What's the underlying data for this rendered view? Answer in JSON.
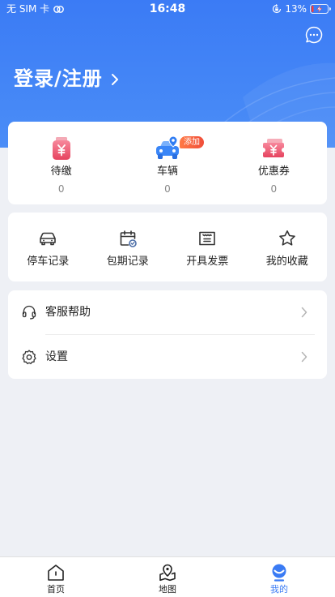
{
  "status_bar": {
    "carrier": "无 SIM 卡",
    "time": "16:48",
    "battery_text": "13%",
    "battery_level": 13
  },
  "header": {
    "login_label": "登录/注册"
  },
  "quick": {
    "items": [
      {
        "label": "待缴",
        "count": "0",
        "icon": "wallet-yuan-icon"
      },
      {
        "label": "车辆",
        "count": "0",
        "icon": "car-icon",
        "badge": "添加"
      },
      {
        "label": "优惠券",
        "count": "0",
        "icon": "coupon-icon"
      }
    ]
  },
  "services": {
    "items": [
      {
        "label": "停车记录",
        "icon": "car-outline-icon"
      },
      {
        "label": "包期记录",
        "icon": "calendar-check-icon"
      },
      {
        "label": "开具发票",
        "icon": "invoice-icon"
      },
      {
        "label": "我的收藏",
        "icon": "star-icon"
      }
    ]
  },
  "menu": {
    "items": [
      {
        "label": "客服帮助",
        "icon": "headset-icon"
      },
      {
        "label": "设置",
        "icon": "gear-icon"
      }
    ]
  },
  "tabbar": {
    "items": [
      {
        "label": "首页",
        "icon": "home-icon",
        "active": false
      },
      {
        "label": "地图",
        "icon": "map-icon",
        "active": false
      },
      {
        "label": "我的",
        "icon": "profile-icon",
        "active": true
      }
    ]
  },
  "colors": {
    "accent": "#3a7bf4",
    "header_top": "#3b7bf5",
    "header_bottom": "#4b8df7",
    "badge": "#f05a3c",
    "page_background": "#eef0f5",
    "battery_low": "#ff3b30"
  }
}
